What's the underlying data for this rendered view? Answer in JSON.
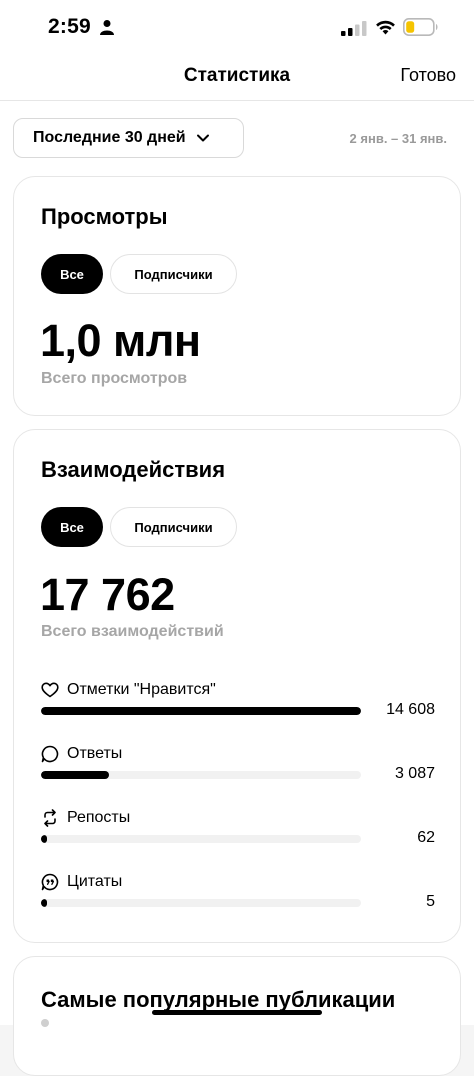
{
  "status_bar": {
    "time": "2:59",
    "person_icon": "person-icon",
    "signal_icon": "cellular-signal-icon",
    "wifi_icon": "wifi-icon",
    "battery_icon": "battery-low-icon",
    "battery_color": "#f5c400"
  },
  "nav": {
    "title": "Статистика",
    "done_label": "Готово"
  },
  "range": {
    "selected": "Последние 30 дней",
    "dates": "2 янв. – 31 янв."
  },
  "views": {
    "title": "Просмотры",
    "filter_all": "Все",
    "filter_followers": "Подписчики",
    "total": "1,0 млн",
    "total_label": "Всего просмотров"
  },
  "interactions": {
    "title": "Взаимодействия",
    "filter_all": "Все",
    "filter_followers": "Подписчики",
    "total": "17 762",
    "total_label": "Всего взаимодействий",
    "metrics": [
      {
        "label": "Отметки \"Нравится\"",
        "value": "14 608",
        "icon": "heart-icon",
        "fraction": 1.0
      },
      {
        "label": "Ответы",
        "value": "3 087",
        "icon": "reply-bubble-icon",
        "fraction": 0.211
      },
      {
        "label": "Репосты",
        "value": "62",
        "icon": "repost-icon",
        "fraction": 0.004
      },
      {
        "label": "Цитаты",
        "value": "5",
        "icon": "quote-icon",
        "fraction": 0.0003
      }
    ]
  },
  "top_posts": {
    "title": "Самые популярные публикации"
  }
}
